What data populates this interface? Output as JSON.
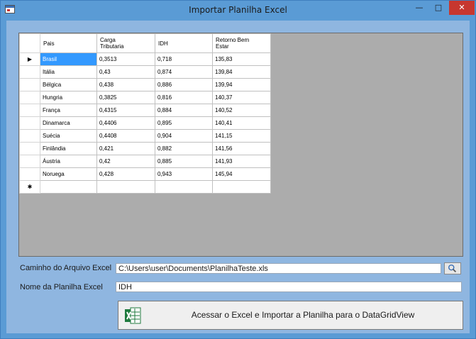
{
  "window": {
    "title": "Importar Planilha Excel"
  },
  "grid": {
    "columns": [
      "Pais",
      "Carga\nTributaria",
      "IDH",
      "Retorno Bem\nEstar"
    ],
    "rows": [
      [
        "Brasil",
        "0,3513",
        "0,718",
        "135,83"
      ],
      [
        "Itália",
        "0,43",
        "0,874",
        "139,84"
      ],
      [
        "Bélgica",
        "0,438",
        "0,886",
        "139,94"
      ],
      [
        "Hungria",
        "0,3825",
        "0,816",
        "140,37"
      ],
      [
        "França",
        "0,4315",
        "0,884",
        "140,52"
      ],
      [
        "Dinamarca",
        "0,4406",
        "0,895",
        "140,41"
      ],
      [
        "Suécia",
        "0,4408",
        "0,904",
        "141,15"
      ],
      [
        "Finlândia",
        "0,421",
        "0,882",
        "141,56"
      ],
      [
        "Áustria",
        "0,42",
        "0,885",
        "141,93"
      ],
      [
        "Noruega",
        "0,428",
        "0,943",
        "145,94"
      ]
    ],
    "current_row_marker": "▶",
    "new_row_marker": "✱"
  },
  "form": {
    "path_label": "Caminho do Arquivo Excel",
    "path_value": "C:\\Users\\user\\Documents\\PlanilhaTeste.xls",
    "sheet_label": "Nome da Planilha Excel",
    "sheet_value": "IDH",
    "import_button_label": "Acessar o Excel e Importar a Planilha para o DataGridView"
  },
  "icons": {
    "browse": "magnifier-icon",
    "import": "excel-icon",
    "app": "form-icon"
  },
  "colors": {
    "window_frame": "#5a9bd5",
    "client": "#8fb6e0",
    "grid_background": "#acacac",
    "selection": "#3399ff",
    "close_button": "#c7372f"
  }
}
